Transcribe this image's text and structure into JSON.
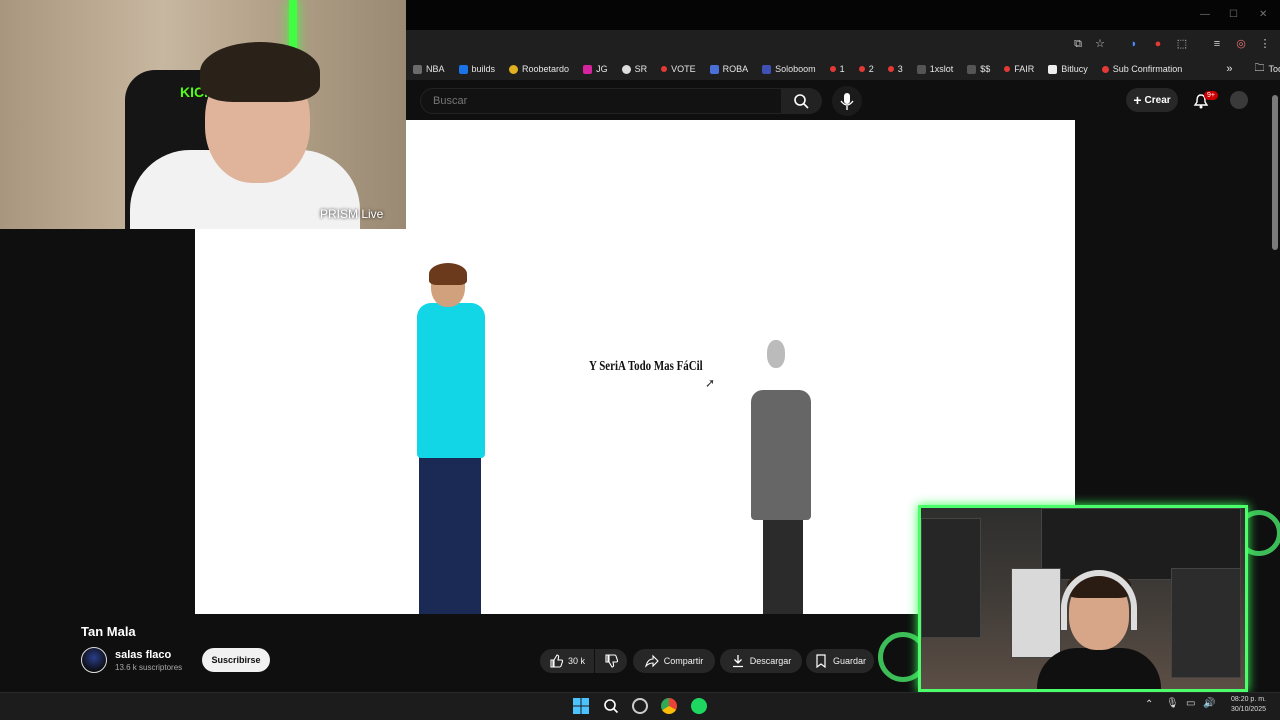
{
  "bookmarks": [
    {
      "label": "NBA",
      "color": "#6b6b6b"
    },
    {
      "label": "builds",
      "color": "#1a73e8"
    },
    {
      "label": "Roobetardo",
      "color": "#e0b020"
    },
    {
      "label": "JG",
      "color": "#d6249f"
    },
    {
      "label": "SR",
      "color": "#dddddd"
    },
    {
      "label": "VOTE",
      "color": "#e53935"
    },
    {
      "label": "ROBA",
      "color": "#4a6fd6"
    },
    {
      "label": "Soloboom",
      "color": "#3f51b5"
    },
    {
      "label": "1",
      "color": "#e53935"
    },
    {
      "label": "2",
      "color": "#e53935"
    },
    {
      "label": "3",
      "color": "#e53935"
    },
    {
      "label": "1xslot",
      "color": "#555555"
    },
    {
      "label": "$$",
      "color": "#555555"
    },
    {
      "label": "FAIR",
      "color": "#e53935"
    },
    {
      "label": "Bitlucy",
      "color": "#eeeeee"
    },
    {
      "label": "Sub Confirmation",
      "color": "#e53935"
    }
  ],
  "bookmarks_overflow": "»",
  "all_bookmarks": "Todos los favoritos",
  "search": {
    "placeholder": "Buscar"
  },
  "create_label": "Crear",
  "notif_badge": "9+",
  "webcam_label": "PRISM Live",
  "webcam_brand": "KICK",
  "video": {
    "caption": "Y SeriA Todo Mas FáCil"
  },
  "title": "Tan Mala",
  "channel": {
    "name": "salas flaco",
    "subscribers": "13.6 k suscriptores"
  },
  "subscribe_label": "Suscribirse",
  "actions": {
    "likes": "30 k",
    "share": "Compartir",
    "download": "Descargar",
    "save": "Guardar"
  },
  "tray": {
    "time": "08:20 p. m.",
    "date": "30/10/2025"
  },
  "colors": {
    "accent_green": "#48e86a",
    "kick_green": "#53fc18",
    "yt_red": "#cc0000"
  }
}
